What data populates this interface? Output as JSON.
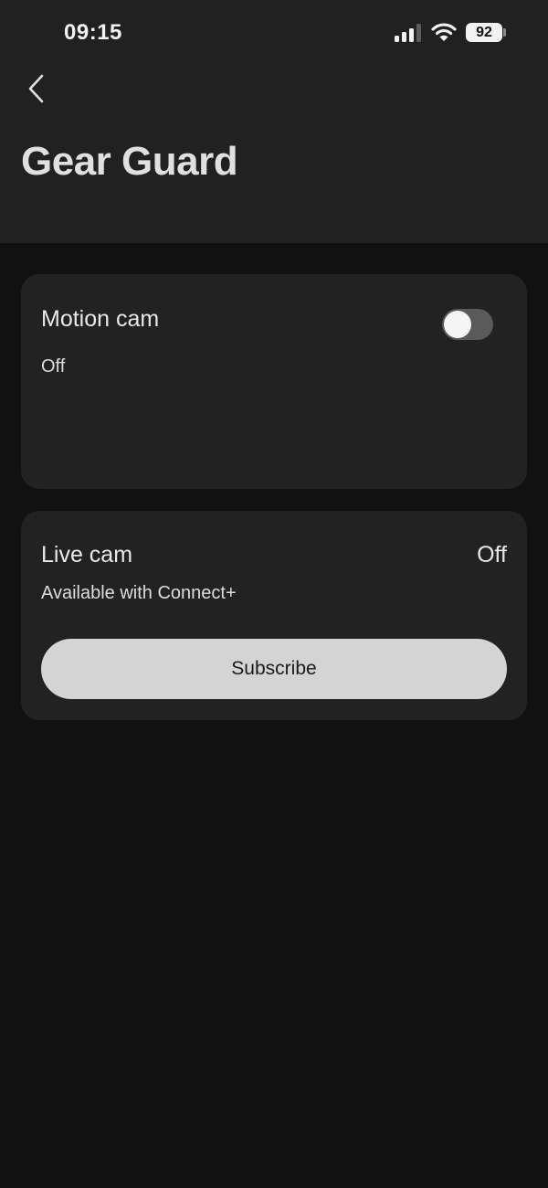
{
  "status_bar": {
    "time": "09:15",
    "battery": "92"
  },
  "header": {
    "back_icon": "chevron-left-icon",
    "title": "Gear Guard"
  },
  "motion_cam": {
    "title": "Motion cam",
    "status": "Off",
    "toggle_on": false
  },
  "live_cam": {
    "title": "Live cam",
    "status": "Off",
    "subtitle": "Available with Connect+",
    "button_label": "Subscribe"
  },
  "colors": {
    "background": "#111111",
    "header_bg": "#212121",
    "card_bg": "#222222",
    "button_bg": "#d4d4d4",
    "toggle_track_off": "#5a5a5a"
  }
}
